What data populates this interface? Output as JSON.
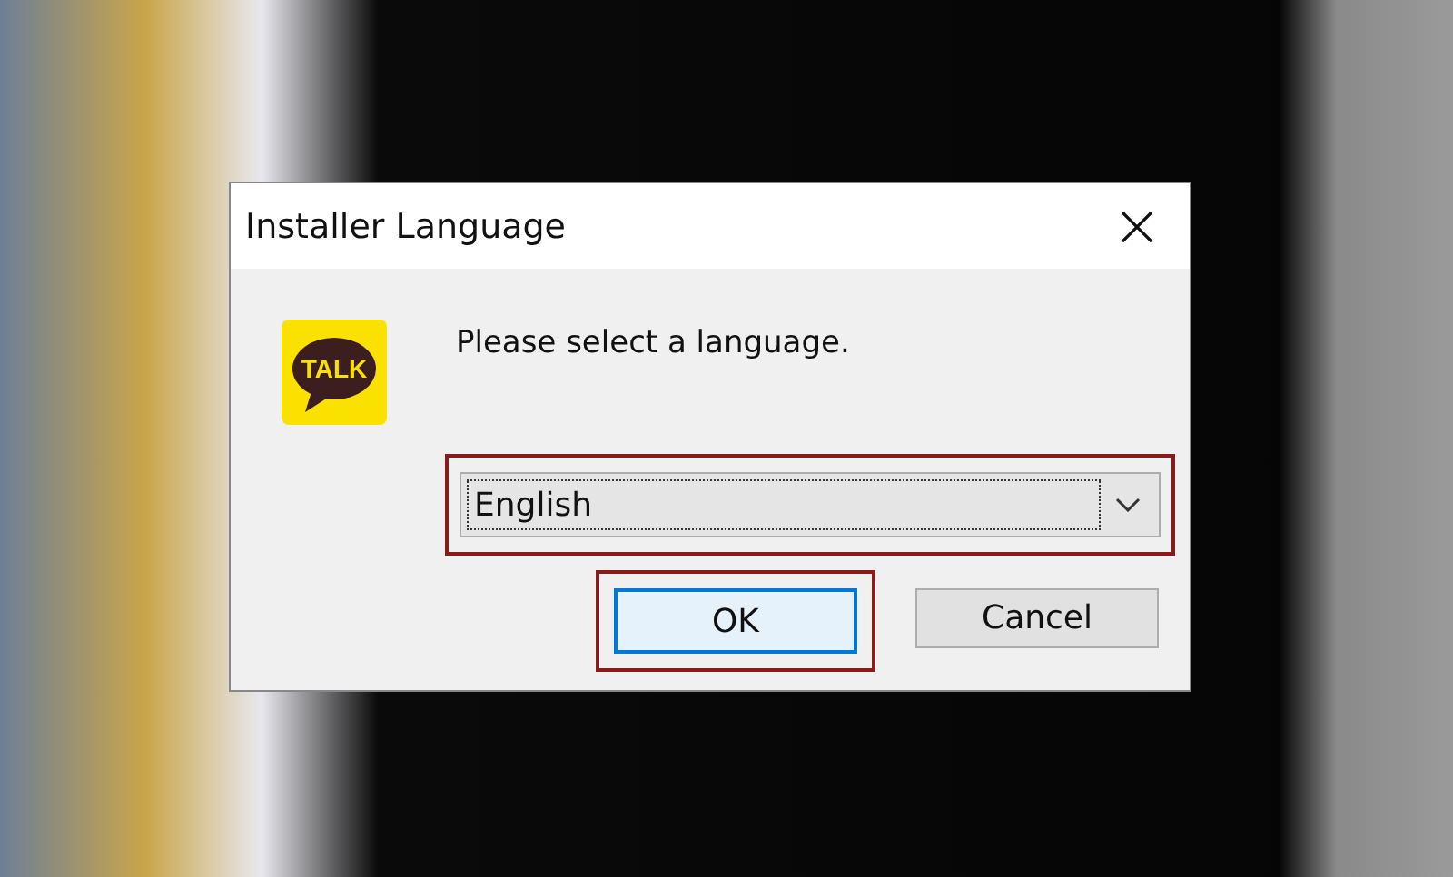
{
  "window": {
    "title": "Installer Language"
  },
  "app_icon": {
    "text": "TALK"
  },
  "message": "Please select a language.",
  "language_dropdown": {
    "value": "English",
    "focused": true,
    "highlighted": true
  },
  "buttons": [
    {
      "label": "OK",
      "default": true,
      "highlighted": true
    },
    {
      "label": "Cancel",
      "default": false,
      "highlighted": false
    }
  ]
}
